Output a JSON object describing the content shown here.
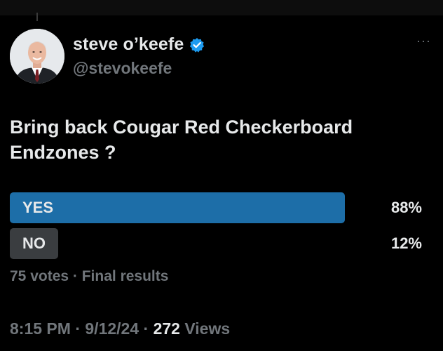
{
  "author": {
    "display_name": "steve o’keefe",
    "handle": "@stevokeefe",
    "verified_icon": "verified-badge-icon",
    "avatar_icon": "profile-photo"
  },
  "more_label": "···",
  "tweet": {
    "question": "Bring back Cougar Red Checkerboard Endzones ?"
  },
  "poll": {
    "options": [
      {
        "label": "YES",
        "percent_text": "88%",
        "share": 0.88,
        "color": "#1d6ea8"
      },
      {
        "label": "NO",
        "percent_text": "12%",
        "share": 0.12,
        "color": "#3a3d40"
      }
    ],
    "votes_text": "75 votes",
    "separator": " · ",
    "status_text": "Final results"
  },
  "footer": {
    "time": "8:15 PM",
    "sep1": " · ",
    "date": "9/12/24",
    "sep2": " · ",
    "views_count": "272",
    "views_label": " Views"
  },
  "colors": {
    "accent": "#1d9bf0",
    "winner_bar": "#1d6ea8",
    "loser_bar": "#3a3d40",
    "text_primary": "#e7e9ea",
    "text_secondary": "#71767b"
  }
}
